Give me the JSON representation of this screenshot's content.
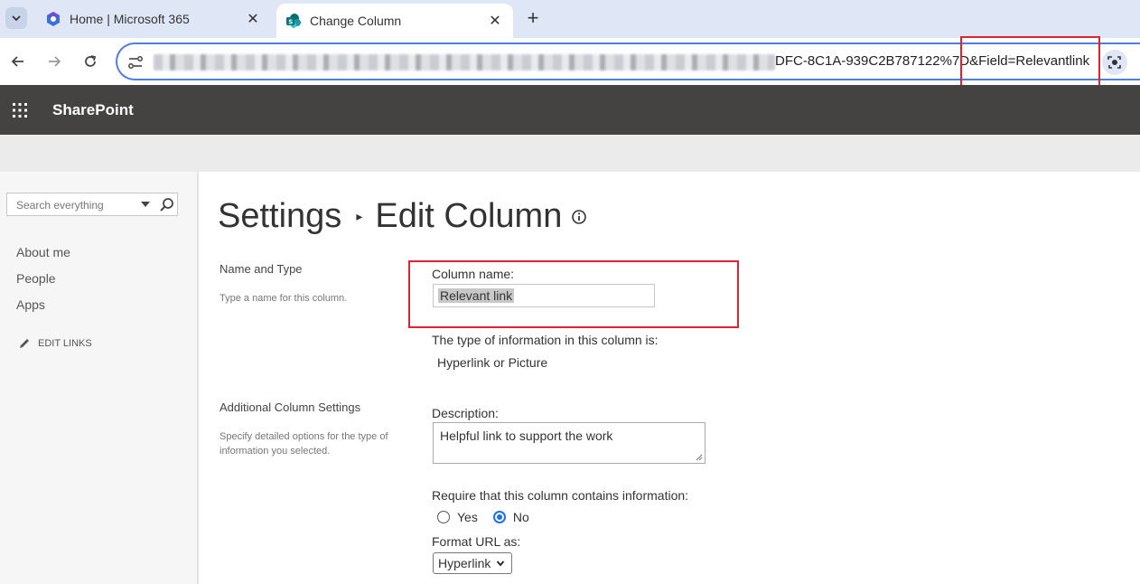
{
  "browser": {
    "tabs": [
      {
        "label": "Home | Microsoft 365",
        "active": false
      },
      {
        "label": "Change Column",
        "active": true
      }
    ],
    "new_tab_symbol": "+",
    "address_visible": "DFC-8C1A-939C2B787122%7D&Field=Relevantlink",
    "icons": [
      "chevron-down-icon",
      "m365-icon",
      "sharepoint-icon",
      "close-icon",
      "plus-icon",
      "back-arrow-icon",
      "forward-arrow-icon",
      "reload-icon",
      "site-settings-icon",
      "lens-icon"
    ]
  },
  "suite": {
    "brand": "SharePoint",
    "colors": {
      "suite_bar": "#444342",
      "highlight": "#e0232e",
      "accent": "#1a73e8"
    }
  },
  "leftnav": {
    "search_placeholder": "Search everything",
    "links": [
      "About me",
      "People",
      "Apps"
    ],
    "edit_links": "EDIT LINKS"
  },
  "page": {
    "breadcrumb_root": "Settings",
    "breadcrumb_separator": "▸",
    "title": "Edit Column"
  },
  "form": {
    "name_type": {
      "title": "Name and Type",
      "description": "Type a name for this column.",
      "column_name_label": "Column name:",
      "column_name_value": "Relevant link",
      "type_label": "The type of information in this column is:",
      "type_value": "Hyperlink or Picture"
    },
    "additional": {
      "title": "Additional Column Settings",
      "description": "Specify detailed options for the type of information you selected.",
      "description_label": "Description:",
      "description_value": "Helpful link to support the work",
      "require_label": "Require that this column contains information:",
      "yes_label": "Yes",
      "no_label": "No",
      "require_selected": "No",
      "format_label": "Format URL as:",
      "format_value": "Hyperlink"
    }
  }
}
